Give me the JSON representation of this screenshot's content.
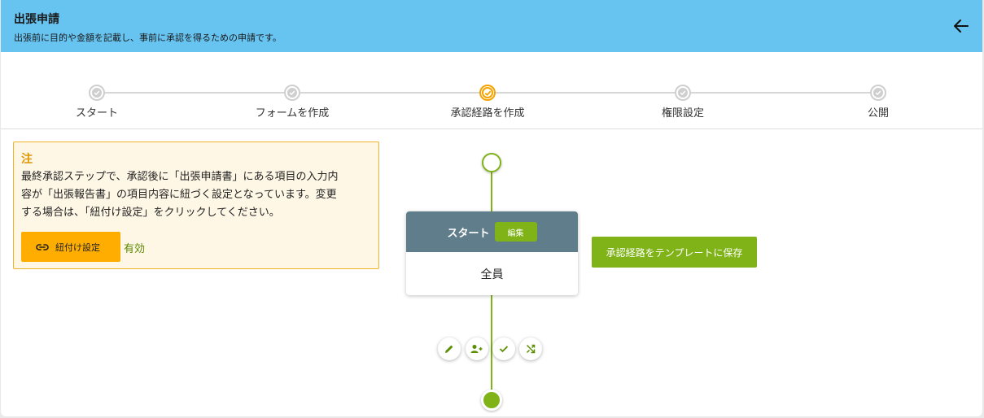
{
  "header": {
    "title": "出張申請",
    "subtitle": "出張前に目的や金額を記載し、事前に承認を得るための申請です。",
    "back_icon": "arrow-left-icon",
    "bg_color": "#67c3f0"
  },
  "stepper": {
    "steps": [
      {
        "label": "スタート",
        "state": "done"
      },
      {
        "label": "フォームを作成",
        "state": "done"
      },
      {
        "label": "承認経路を作成",
        "state": "active"
      },
      {
        "label": "権限設定",
        "state": "todo"
      },
      {
        "label": "公開",
        "state": "todo"
      }
    ],
    "active_color": "#f4a300"
  },
  "note": {
    "title": "注",
    "lines": [
      "最終承認ステップで、承認後に「出張申請書」にある項目の入力内",
      "容が「出張報告書」の項目内容に紐づく設定となっています。変更",
      "する場合は、「紐付け設定」をクリックしてください。"
    ],
    "link_button_label": "紐付け設定",
    "link_button_icon": "link-icon",
    "status_text": "有効"
  },
  "flow": {
    "card": {
      "title": "スタート",
      "edit_label": "編集",
      "assignee": "全員"
    },
    "save_template_label": "承認経路をテンプレートに保存",
    "actions": [
      {
        "name": "edit-step-button",
        "icon": "pencil-icon"
      },
      {
        "name": "add-approver-button",
        "icon": "person-add-icon"
      },
      {
        "name": "approve-step-button",
        "icon": "check-icon"
      },
      {
        "name": "branch-button",
        "icon": "shuffle-icon"
      }
    ],
    "line_color": "#7fb317"
  }
}
